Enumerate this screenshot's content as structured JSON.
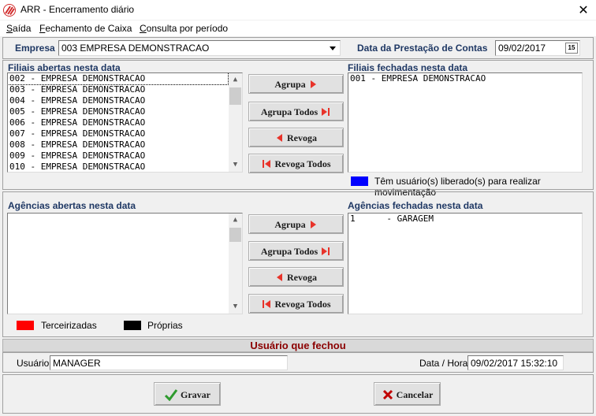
{
  "window": {
    "title": "ARR - Encerramento diário",
    "close_glyph": "✕"
  },
  "menu": [
    {
      "label": "Saída",
      "underline": "S",
      "rest": "aída"
    },
    {
      "label": "Fechamento de Caixa",
      "underline": "F",
      "rest": "echamento de Caixa"
    },
    {
      "label": "Consulta por período",
      "underline": "C",
      "rest": "onsulta por período"
    }
  ],
  "header": {
    "empresa_label": "Empresa",
    "empresa_value": "003 EMPRESA DEMONSTRACAO",
    "data_label": "Data da Prestação de Contas",
    "data_value": "09/02/2017",
    "calendar_glyph": "15"
  },
  "filiais": {
    "open_title": "Filiais abertas nesta data",
    "closed_title": "Filiais fechadas nesta data",
    "open_items": [
      "002 - EMPRESA DEMONSTRACAO",
      "003 - EMPRESA DEMONSTRACAO",
      "004 - EMPRESA DEMONSTRACAO",
      "005 - EMPRESA DEMONSTRACAO",
      "006 - EMPRESA DEMONSTRACAO",
      "007 - EMPRESA DEMONSTRACAO",
      "008 - EMPRESA DEMONSTRACAO",
      "009 - EMPRESA DEMONSTRACAO",
      "010 - EMPRESA DEMONSTRACAO"
    ],
    "closed_items": [
      "001 - EMPRESA DEMONSTRACAO"
    ],
    "legend_text": "Têm usuário(s) liberado(s) para realizar movimentação",
    "legend_color": "#0000ff"
  },
  "agencias": {
    "open_title": "Agências abertas nesta data",
    "closed_title": "Agências fechadas nesta data",
    "closed_items": [
      "1      - GARAGEM"
    ]
  },
  "buttons": {
    "agrupa": "Agrupa",
    "agrupa_todos": "Agrupa Todos",
    "revoga": "Revoga",
    "revoga_todos": "Revoga Todos"
  },
  "legend": {
    "terceirizadas": "Terceirizadas",
    "terceirizadas_color": "#ff0000",
    "proprias": "Próprias",
    "proprias_color": "#000000"
  },
  "closed_by": {
    "title": "Usuário que fechou",
    "usuario_label": "Usuário",
    "usuario_value": "MANAGER",
    "datahora_label": "Data / Hora",
    "datahora_value": "09/02/2017 15:32:10"
  },
  "footer": {
    "gravar": "Gravar",
    "cancelar": "Cancelar"
  },
  "colors": {
    "accent_red": "#8b0000",
    "label_navy": "#1f3864"
  }
}
